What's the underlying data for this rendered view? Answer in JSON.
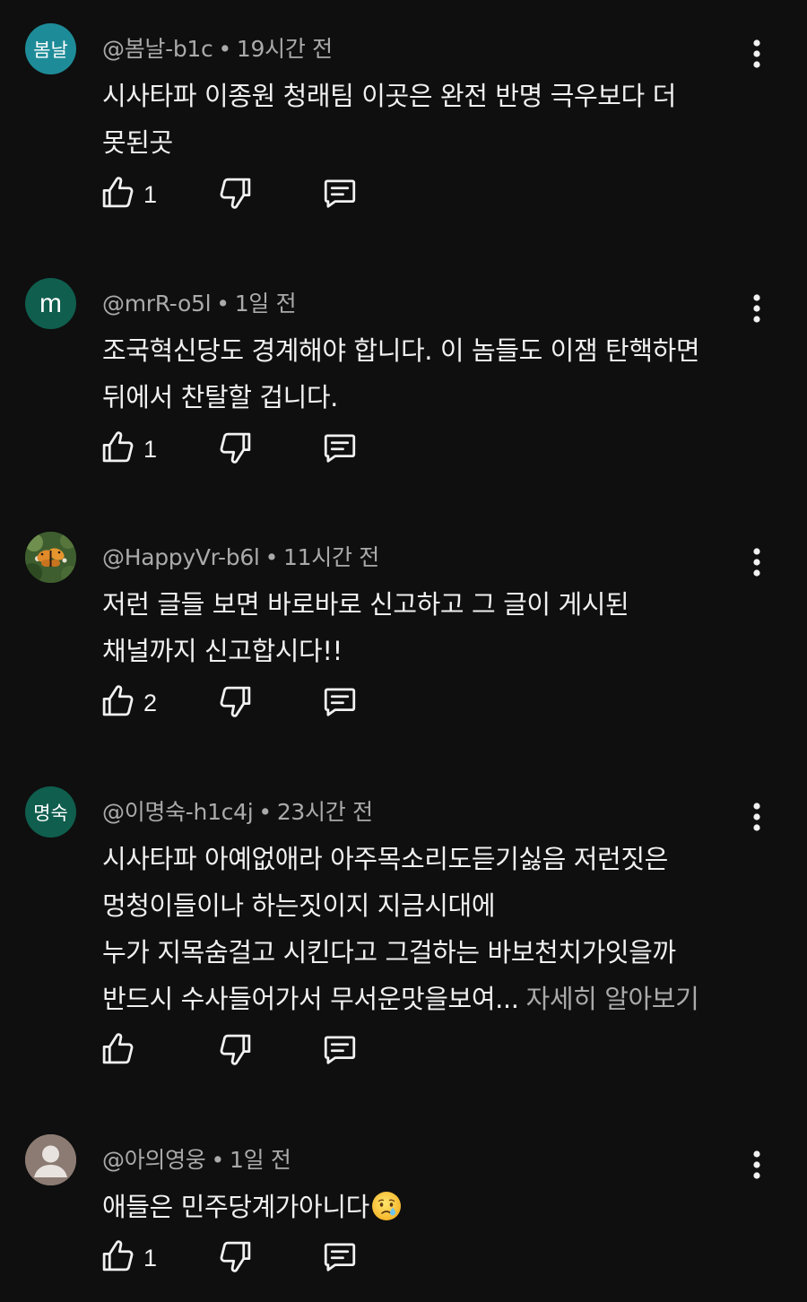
{
  "comments": [
    {
      "avatar_text": "봄날",
      "avatar_color": "#1e8c98",
      "handle": "@봄날-b1c",
      "time": "19시간 전",
      "lines": [
        "시사타파 이종원 청래팀 이곳은 완전 반명 극우보다 더",
        "못된곳"
      ],
      "likes": "1"
    },
    {
      "avatar_text": "m",
      "avatar_color": "#0f5e4e",
      "handle": "@mrR-o5l",
      "time": "1일 전",
      "lines": [
        "조국혁신당도 경계해야 합니다. 이 놈들도 이잼 탄핵하면",
        "뒤에서 찬탈할 겁니다."
      ],
      "likes": "1"
    },
    {
      "avatar_icon": "butterfly-photo-avatar",
      "handle": "@HappyVr-b6l",
      "time": "11시간 전",
      "lines": [
        "저런 글들 보면 바로바로 신고하고 그 글이 게시된",
        "채널까지 신고합시다!!"
      ],
      "likes": "2"
    },
    {
      "avatar_text": "명숙",
      "avatar_color": "#0f5e4e",
      "handle": "@이명숙-h1c4j",
      "time": "23시간 전",
      "lines": [
        "시사타파 아예없애라 아주목소리도듣기싫음 저런짓은",
        "멍청이들이나 하는짓이지 지금시대에",
        "누가 지목숨걸고 시킨다고 그걸하는 바보천치가잇을까",
        "반드시 수사들어가서 무서운맛을보여..."
      ],
      "more_label": "자세히 알아보기",
      "likes": ""
    },
    {
      "avatar_icon": "default-person-avatar",
      "avatar_color": "#8b7b72",
      "handle": "@아의영웅",
      "time": "1일 전",
      "lines": [
        "애들은 민주당계가아니다"
      ],
      "trailing_emoji": "crying-face-emoji",
      "likes": "1"
    }
  ],
  "meta_separator": "•",
  "icons": {
    "like": "thumbs-up-icon",
    "dislike": "thumbs-down-icon",
    "reply": "reply-comment-icon",
    "menu": "more-vert-icon"
  },
  "colors": {
    "background": "#0f0f0f",
    "primary_text": "#f1f1f1",
    "secondary_text": "#aaaaaa"
  }
}
